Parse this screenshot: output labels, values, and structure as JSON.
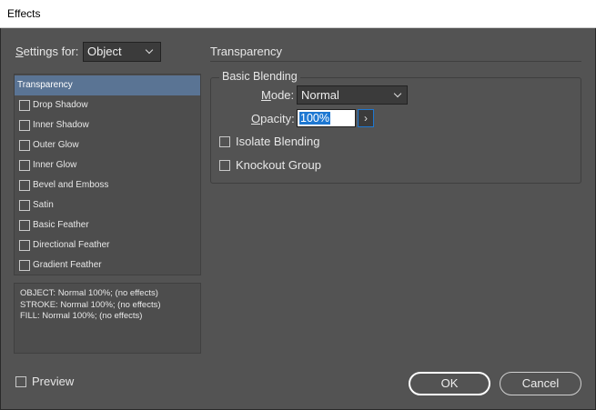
{
  "window": {
    "title": "Effects"
  },
  "settings": {
    "label": "Settings for:",
    "value": "Object"
  },
  "effects": [
    {
      "label": "Transparency",
      "selected": true
    },
    {
      "label": "Drop Shadow"
    },
    {
      "label": "Inner Shadow"
    },
    {
      "label": "Outer Glow"
    },
    {
      "label": "Inner Glow"
    },
    {
      "label": "Bevel and Emboss"
    },
    {
      "label": "Satin"
    },
    {
      "label": "Basic Feather"
    },
    {
      "label": "Directional Feather"
    },
    {
      "label": "Gradient Feather"
    }
  ],
  "summary": [
    "OBJECT: Normal 100%; (no effects)",
    "STROKE: Normal 100%; (no effects)",
    "FILL: Normal 100%; (no effects)"
  ],
  "panel": {
    "title": "Transparency",
    "group_title": "Basic Blending",
    "mode_label": "Mode:",
    "mode_value": "Normal",
    "opacity_label": "Opacity:",
    "opacity_value": "100%",
    "opacity_arrow": "›",
    "isolate_blending": "Isolate Blending",
    "knockout_group": "Knockout Group"
  },
  "footer": {
    "preview_label": "Preview",
    "ok_label": "OK",
    "cancel_label": "Cancel"
  },
  "colors": {
    "dialog_bg": "#535353",
    "selection": "#5a7494",
    "focus_accent": "#1e78d2"
  }
}
